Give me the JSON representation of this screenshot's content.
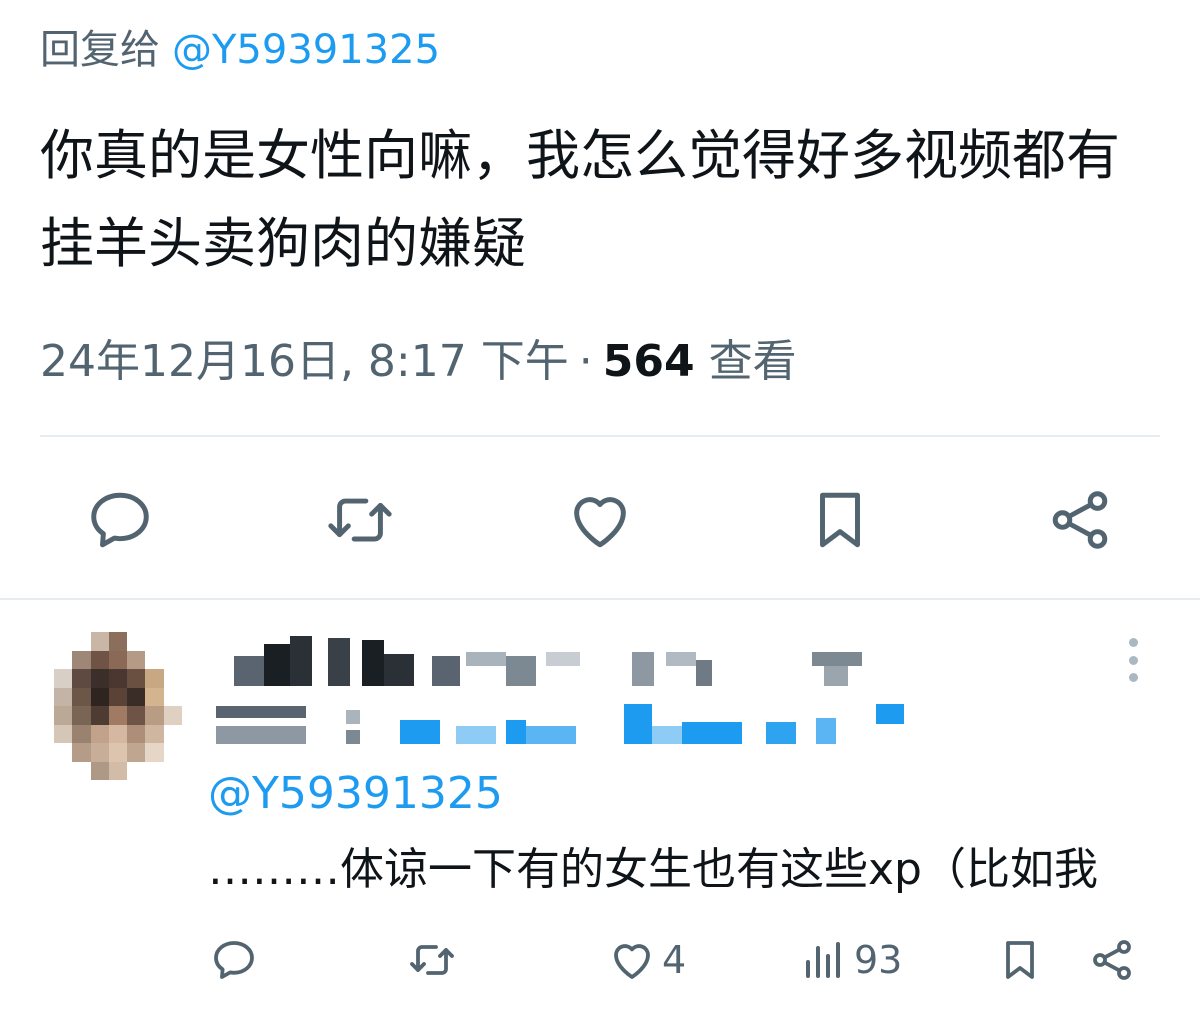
{
  "tweet": {
    "reply_prefix": "回复给",
    "reply_handle": "@Y59391325",
    "text": "你真的是女性向嘛，我怎么觉得好多视频都有挂羊头卖狗肉的嫌疑",
    "timestamp": "24年12月16日, 8:17 下午",
    "separator": "·",
    "views_count": "564",
    "views_label": "查看"
  },
  "actions": [
    {
      "name": "reply",
      "icon": "reply-icon"
    },
    {
      "name": "retweet",
      "icon": "retweet-icon"
    },
    {
      "name": "like",
      "icon": "heart-icon"
    },
    {
      "name": "bookmark",
      "icon": "bookmark-icon"
    },
    {
      "name": "share",
      "icon": "share-icon"
    }
  ],
  "reply": {
    "mention": "@Y59391325",
    "text": "………体谅一下有的女生也有这些xp（比如我",
    "likes": "4",
    "views": "93"
  },
  "colors": {
    "text_primary": "#0f1419",
    "text_secondary": "#536471",
    "link": "#1d9bf0",
    "divider": "#e6ecf0"
  }
}
